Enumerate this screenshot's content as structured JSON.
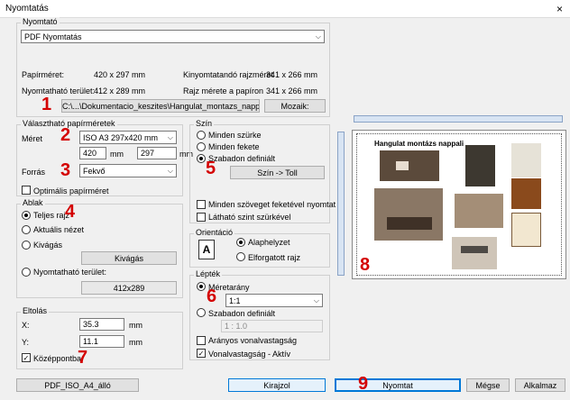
{
  "window": {
    "title": "Nyomtatás",
    "close": "×"
  },
  "printer": {
    "group_label": "Nyomtató",
    "selected": "PDF Nyomtatás",
    "paper_size_label": "Papírméret:",
    "paper_size": "420 x 297 mm",
    "printable_area_label": "Nyomtatható terület:",
    "printable_area": "412 x 289 mm",
    "drawing_to_print_label": "Kinyomtatandó rajzméret",
    "drawing_to_print": "341 x 266 mm",
    "drawing_on_paper_label": "Rajz mérete a papíron",
    "drawing_on_paper": "341 x 266 mm",
    "path_button": "C:\\...\\Dokumentacio_keszites\\Hangulat_montazs_nappali.pdf",
    "mosaic_button": "Mozaik:"
  },
  "paper": {
    "group_label": "Választható papírméretek",
    "size_label": "Méret",
    "size_value": "ISO A3 297x420 mm",
    "width": "420",
    "height": "297",
    "unit": "mm",
    "source_label": "Forrás",
    "source_value": "Fekvő",
    "optimal_label": "Optimális papírméret"
  },
  "window_group": {
    "group_label": "Ablak",
    "full_drawing": "Teljes rajz",
    "current_view": "Aktuális nézet",
    "cutout": "Kivágás",
    "cutout_button": "Kivágás",
    "printable_area": "Nyomtatható terület:",
    "printable_value": "412x289"
  },
  "offset": {
    "group_label": "Eltolás",
    "x_label": "X:",
    "x_value": "35.3",
    "y_label": "Y:",
    "y_value": "11.1",
    "unit": "mm",
    "center_label": "Középpontba"
  },
  "color": {
    "group_label": "Szín",
    "grayscale": "Minden szürke",
    "black": "Minden fekete",
    "custom": "Szabadon definiált",
    "pen_button": "Szín -> Toll",
    "text_black": "Minden szöveget feketével nyomtat",
    "layer_gray": "Látható szint szürkével"
  },
  "orientation": {
    "group_label": "Orientáció",
    "default": "Alaphelyzet",
    "rotated": "Elforgatott rajz"
  },
  "scale": {
    "group_label": "Lépték",
    "ratio_label": "Méretarány",
    "ratio_value": "1:1",
    "custom_label": "Szabadon definiált",
    "custom_value": "1 : 1.0",
    "proportional": "Arányos vonalvastagság",
    "line_active": "Vonalvastagság - Aktív"
  },
  "preview": {
    "heading": "Hangulat montázs nappali"
  },
  "bottom": {
    "preset": "PDF_ISO_A4_álló",
    "draw": "Kirajzol",
    "print": "Nyomtat",
    "cancel": "Mégse",
    "apply": "Alkalmaz"
  },
  "markers": [
    "1",
    "2",
    "3",
    "4",
    "5",
    "6",
    "7",
    "8",
    "9"
  ],
  "colors": {
    "marker": "#d40000",
    "accent": "#0078d7"
  }
}
